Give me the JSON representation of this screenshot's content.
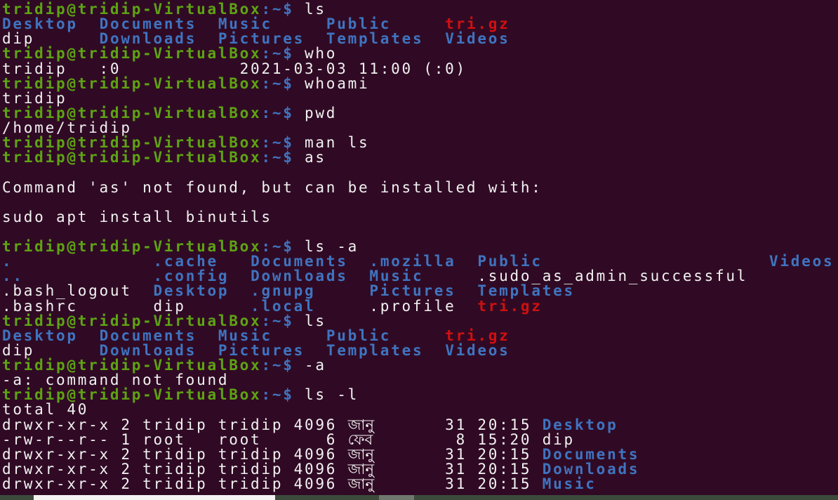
{
  "colors": {
    "background": "#300a24",
    "prompt": "#5ea313",
    "directory": "#3f74c0",
    "archive": "#d01010",
    "text": "#f2f2f2"
  },
  "lines": [
    [
      [
        "tridip@tridip-VirtualBox",
        "g"
      ],
      [
        ":~$",
        "b"
      ],
      [
        " ls",
        "w"
      ]
    ],
    [
      [
        "Desktop",
        "b"
      ],
      [
        "  ",
        "w"
      ],
      [
        "Documents",
        "b"
      ],
      [
        "  ",
        "w"
      ],
      [
        "Music",
        "b"
      ],
      [
        "     ",
        "w"
      ],
      [
        "Public",
        "b"
      ],
      [
        "     ",
        "w"
      ],
      [
        "tri.gz",
        "r"
      ]
    ],
    [
      [
        "dip      ",
        "w"
      ],
      [
        "Downloads",
        "b"
      ],
      [
        "  ",
        "w"
      ],
      [
        "Pictures",
        "b"
      ],
      [
        "  ",
        "w"
      ],
      [
        "Templates",
        "b"
      ],
      [
        "  ",
        "w"
      ],
      [
        "Videos",
        "b"
      ]
    ],
    [
      [
        "tridip@tridip-VirtualBox",
        "g"
      ],
      [
        ":~$",
        "b"
      ],
      [
        " who",
        "w"
      ]
    ],
    [
      [
        "tridip   :0           2021-03-03 11:00 (:0)",
        "w"
      ]
    ],
    [
      [
        "tridip@tridip-VirtualBox",
        "g"
      ],
      [
        ":~$",
        "b"
      ],
      [
        " whoami",
        "w"
      ]
    ],
    [
      [
        "tridip",
        "w"
      ]
    ],
    [
      [
        "tridip@tridip-VirtualBox",
        "g"
      ],
      [
        ":~$",
        "b"
      ],
      [
        " pwd",
        "w"
      ]
    ],
    [
      [
        "/home/tridip",
        "w"
      ]
    ],
    [
      [
        "tridip@tridip-VirtualBox",
        "g"
      ],
      [
        ":~$",
        "b"
      ],
      [
        " man ls",
        "w"
      ]
    ],
    [
      [
        "tridip@tridip-VirtualBox",
        "g"
      ],
      [
        ":~$",
        "b"
      ],
      [
        " as",
        "w"
      ]
    ],
    [],
    [
      [
        "Command 'as' not found, but can be installed with:",
        "w"
      ]
    ],
    [],
    [
      [
        "sudo apt install binutils",
        "w"
      ]
    ],
    [],
    [
      [
        "tridip@tridip-VirtualBox",
        "g"
      ],
      [
        ":~$",
        "b"
      ],
      [
        " ls -a",
        "w"
      ]
    ],
    [
      [
        ".",
        "b"
      ],
      [
        "             ",
        "w"
      ],
      [
        ".cache",
        "b"
      ],
      [
        "   ",
        "w"
      ],
      [
        "Documents",
        "b"
      ],
      [
        "  ",
        "w"
      ],
      [
        ".mozilla",
        "b"
      ],
      [
        "  ",
        "w"
      ],
      [
        "Public",
        "b"
      ],
      [
        "                     ",
        "w"
      ],
      [
        "Videos",
        "b"
      ]
    ],
    [
      [
        "..",
        "b"
      ],
      [
        "            ",
        "w"
      ],
      [
        ".config",
        "b"
      ],
      [
        "  ",
        "w"
      ],
      [
        "Downloads",
        "b"
      ],
      [
        "  ",
        "w"
      ],
      [
        "Music",
        "b"
      ],
      [
        "     ",
        "w"
      ],
      [
        ".sudo_as_admin_successful",
        "w"
      ]
    ],
    [
      [
        ".bash_logout  ",
        "w"
      ],
      [
        "Desktop",
        "b"
      ],
      [
        "  ",
        "w"
      ],
      [
        ".gnupg",
        "b"
      ],
      [
        "     ",
        "w"
      ],
      [
        "Pictures",
        "b"
      ],
      [
        "  ",
        "w"
      ],
      [
        "Templates",
        "b"
      ]
    ],
    [
      [
        ".bashrc       dip      ",
        "w"
      ],
      [
        ".local",
        "b"
      ],
      [
        "     ",
        "w"
      ],
      [
        ".profile  ",
        "w"
      ],
      [
        "tri.gz",
        "r"
      ]
    ],
    [
      [
        "tridip@tridip-VirtualBox",
        "g"
      ],
      [
        ":~$",
        "b"
      ],
      [
        " ls",
        "w"
      ]
    ],
    [
      [
        "Desktop",
        "b"
      ],
      [
        "  ",
        "w"
      ],
      [
        "Documents",
        "b"
      ],
      [
        "  ",
        "w"
      ],
      [
        "Music",
        "b"
      ],
      [
        "     ",
        "w"
      ],
      [
        "Public",
        "b"
      ],
      [
        "     ",
        "w"
      ],
      [
        "tri.gz",
        "r"
      ]
    ],
    [
      [
        "dip      ",
        "w"
      ],
      [
        "Downloads",
        "b"
      ],
      [
        "  ",
        "w"
      ],
      [
        "Pictures",
        "b"
      ],
      [
        "  ",
        "w"
      ],
      [
        "Templates",
        "b"
      ],
      [
        "  ",
        "w"
      ],
      [
        "Videos",
        "b"
      ]
    ],
    [
      [
        "tridip@tridip-VirtualBox",
        "g"
      ],
      [
        ":~$",
        "b"
      ],
      [
        " -a",
        "w"
      ]
    ],
    [
      [
        "-a: command not found",
        "w"
      ]
    ],
    [
      [
        "tridip@tridip-VirtualBox",
        "g"
      ],
      [
        ":~$",
        "b"
      ],
      [
        " ls -l",
        "w"
      ]
    ],
    [
      [
        "total 40",
        "w"
      ]
    ],
    [
      [
        "drwxr-xr-x 2 tridip tridip 4096 ",
        "w"
      ],
      [
        "জানু",
        "mon"
      ],
      [
        "31 20:15 ",
        "w"
      ],
      [
        "Desktop",
        "b"
      ]
    ],
    [
      [
        "-rw-r--r-- 1 root   root      6 ",
        "w"
      ],
      [
        "ফেব",
        "mon"
      ],
      [
        " 8 15:20 ",
        "w"
      ],
      [
        "dip",
        "w"
      ]
    ],
    [
      [
        "drwxr-xr-x 2 tridip tridip 4096 ",
        "w"
      ],
      [
        "জানু",
        "mon"
      ],
      [
        "31 20:15 ",
        "w"
      ],
      [
        "Documents",
        "b"
      ]
    ],
    [
      [
        "drwxr-xr-x 2 tridip tridip 4096 ",
        "w"
      ],
      [
        "জানু",
        "mon"
      ],
      [
        "31 20:15 ",
        "w"
      ],
      [
        "Downloads",
        "b"
      ]
    ],
    [
      [
        "drwxr-xr-x 2 tridip tridip 4096 ",
        "w"
      ],
      [
        "জানু",
        "mon"
      ],
      [
        "31 20:15 ",
        "w"
      ],
      [
        "Music",
        "b"
      ]
    ]
  ]
}
